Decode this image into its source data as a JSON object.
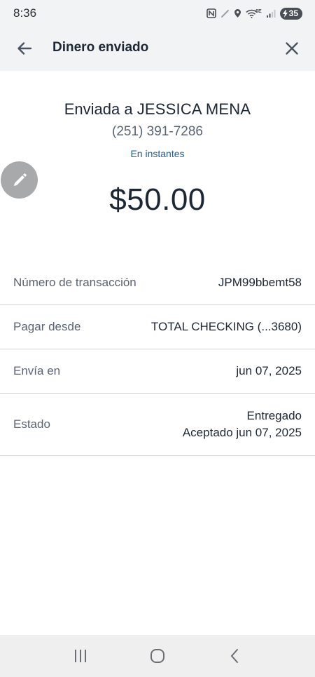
{
  "status_bar": {
    "time": "8:36",
    "battery": "35",
    "network_badge": "6E"
  },
  "header": {
    "title": "Dinero enviado",
    "back_icon": "arrow-left-icon",
    "close_icon": "close-icon"
  },
  "transfer": {
    "sent_prefix": "Enviada a",
    "recipient_name": "JESSICA MENA",
    "phone": "(251) 391-7286",
    "speed": "En instantes",
    "amount": "$50.00",
    "edit_icon": "pencil-icon"
  },
  "details": [
    {
      "label": "Número de transacción",
      "value": "JPM99bbemt58"
    },
    {
      "label": "Pagar desde",
      "value": "TOTAL CHECKING (...3680)"
    },
    {
      "label": "Envía en",
      "value": "jun 07, 2025"
    },
    {
      "label": "Estado",
      "value": "Entregado",
      "value2": "Aceptado jun 07, 2025"
    }
  ],
  "colors": {
    "header_bg": "#f1f3f5",
    "link_blue": "#1f5f8b",
    "text_dark": "#1d2733",
    "text_muted": "#5a6470",
    "fab_gray": "#a7a9ab"
  }
}
